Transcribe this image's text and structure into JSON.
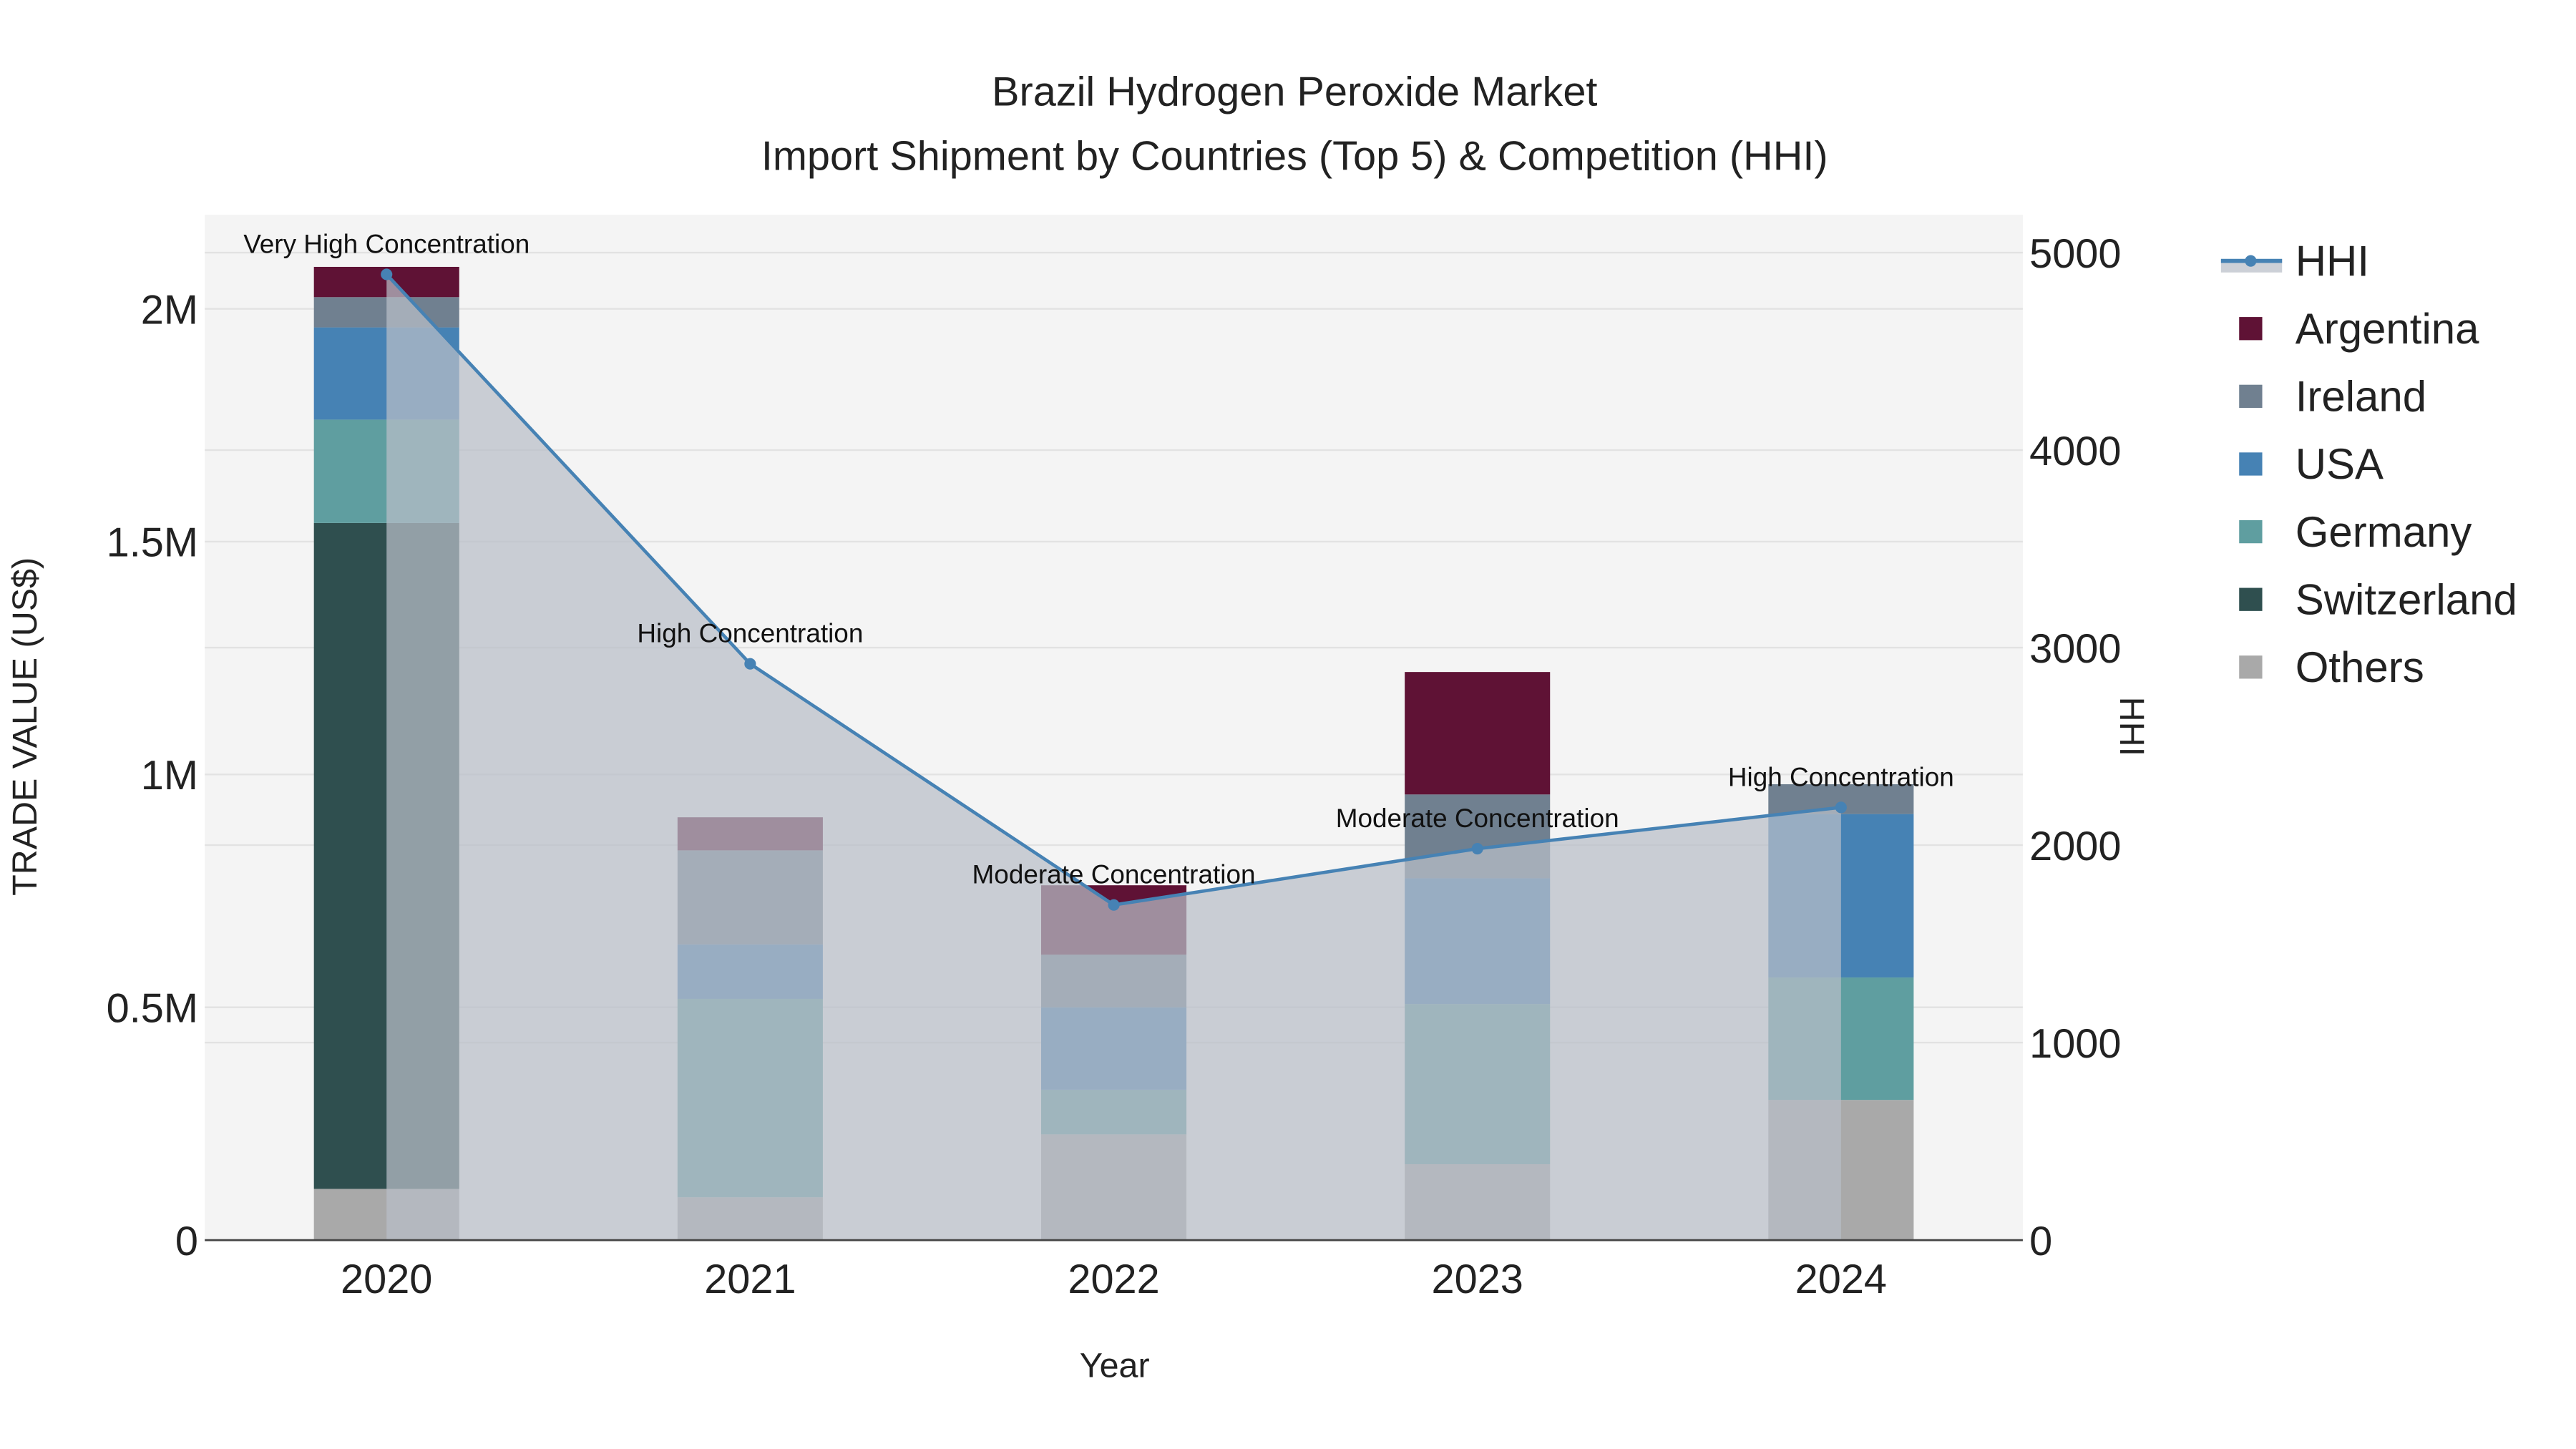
{
  "chart_data": {
    "type": "bar",
    "stacked": true,
    "title": "Brazil Hydrogen Peroxide Market",
    "subtitle": "Import Shipment by Countries (Top 5) & Competition (HHI)",
    "xlabel": "Year",
    "ylabel": "TRADE VALUE (US$)",
    "y2label": "HHI",
    "categories": [
      "2020",
      "2021",
      "2022",
      "2023",
      "2024"
    ],
    "ylim": [
      0,
      2200000
    ],
    "y2lim": [
      0,
      5200
    ],
    "yticks": [
      {
        "v": 0,
        "label": "0"
      },
      {
        "v": 500000,
        "label": "0.5M"
      },
      {
        "v": 1000000,
        "label": "1M"
      },
      {
        "v": 1500000,
        "label": "1.5M"
      },
      {
        "v": 2000000,
        "label": "2M"
      }
    ],
    "y2ticks": [
      {
        "v": 0,
        "label": "0"
      },
      {
        "v": 1000,
        "label": "1000"
      },
      {
        "v": 2000,
        "label": "2000"
      },
      {
        "v": 3000,
        "label": "3000"
      },
      {
        "v": 4000,
        "label": "4000"
      },
      {
        "v": 5000,
        "label": "5000"
      }
    ],
    "series": [
      {
        "name": "Others",
        "color": "#a9a9a9",
        "values": [
          110000,
          92000,
          227000,
          163000,
          301000
        ]
      },
      {
        "name": "Switzerland",
        "color": "#2f4f4f",
        "values": [
          1430000,
          0,
          0,
          0,
          0
        ]
      },
      {
        "name": "Germany",
        "color": "#5f9ea0",
        "values": [
          222000,
          426000,
          96000,
          344000,
          263000
        ]
      },
      {
        "name": "USA",
        "color": "#4682b4",
        "values": [
          198000,
          117000,
          177000,
          270000,
          351000
        ]
      },
      {
        "name": "Ireland",
        "color": "#708090",
        "values": [
          65000,
          202000,
          113000,
          180000,
          64000
        ]
      },
      {
        "name": "Argentina",
        "color": "#5f1235",
        "values": [
          65000,
          71000,
          149000,
          263000,
          0
        ]
      }
    ],
    "hhi": {
      "name": "HHI",
      "color": "#4682b4",
      "values": [
        4890,
        2918,
        1697,
        1982,
        2191
      ],
      "annotations": [
        "Very High Concentration",
        "High Concentration",
        "Moderate Concentration",
        "Moderate Concentration",
        "High Concentration"
      ]
    },
    "legend": {
      "placement": "right",
      "order": [
        "HHI",
        "Argentina",
        "Ireland",
        "USA",
        "Germany",
        "Switzerland",
        "Others"
      ]
    },
    "grid": true
  }
}
